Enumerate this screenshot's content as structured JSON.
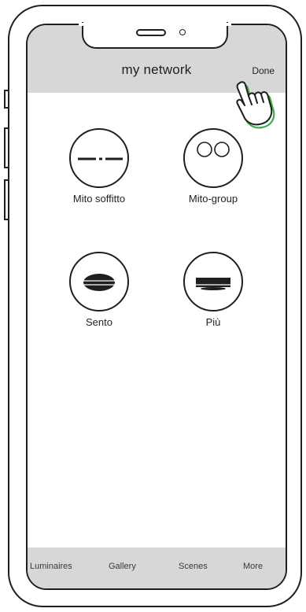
{
  "header": {
    "title": "my network",
    "done_label": "Done"
  },
  "devices": [
    {
      "label": "Mito soffitto",
      "icon": "linear-luminaire-icon"
    },
    {
      "label": "Mito-group",
      "icon": "group-circles-icon"
    },
    {
      "label": "Sento",
      "icon": "pendant-disc-icon"
    },
    {
      "label": "Più",
      "icon": "pendant-bar-icon"
    }
  ],
  "tabs": [
    {
      "label": "Luminaires"
    },
    {
      "label": "Gallery"
    },
    {
      "label": "Scenes"
    },
    {
      "label": "More"
    }
  ],
  "colors": {
    "header_bg": "#d7d7d7",
    "hand_accent": "#3fae49",
    "stroke": "#1f1f1f"
  }
}
